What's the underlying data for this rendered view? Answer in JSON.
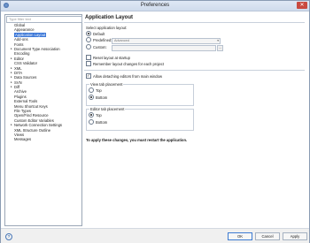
{
  "window": {
    "title": "Preferences"
  },
  "sidebar": {
    "filter_placeholder": "Type filter text",
    "items": [
      {
        "label": "Global",
        "expandable": false,
        "selected": false
      },
      {
        "label": "Appearance",
        "expandable": false,
        "selected": false
      },
      {
        "label": "Application Layout",
        "expandable": false,
        "selected": true
      },
      {
        "label": "Add-ons",
        "expandable": false,
        "selected": false
      },
      {
        "label": "Fonts",
        "expandable": false,
        "selected": false
      },
      {
        "label": "Document Type Association",
        "expandable": true,
        "selected": false
      },
      {
        "label": "Encoding",
        "expandable": false,
        "selected": false
      },
      {
        "label": "Editor",
        "expandable": true,
        "selected": false
      },
      {
        "label": "CSS Validator",
        "expandable": false,
        "selected": false
      },
      {
        "label": "XML",
        "expandable": true,
        "selected": false
      },
      {
        "label": "DITA",
        "expandable": true,
        "selected": false
      },
      {
        "label": "Data Sources",
        "expandable": true,
        "selected": false
      },
      {
        "label": "SVN",
        "expandable": true,
        "selected": false
      },
      {
        "label": "Diff",
        "expandable": true,
        "selected": false
      },
      {
        "label": "Archive",
        "expandable": false,
        "selected": false
      },
      {
        "label": "Plugins",
        "expandable": false,
        "selected": false
      },
      {
        "label": "External Tools",
        "expandable": false,
        "selected": false
      },
      {
        "label": "Menu Shortcut Keys",
        "expandable": false,
        "selected": false
      },
      {
        "label": "File Types",
        "expandable": false,
        "selected": false
      },
      {
        "label": "Open/Find Resource",
        "expandable": false,
        "selected": false
      },
      {
        "label": "Custom Editor Variables",
        "expandable": false,
        "selected": false
      },
      {
        "label": "Network Connection Settings",
        "expandable": true,
        "selected": false
      },
      {
        "label": "XML Structure Outline",
        "expandable": false,
        "selected": false
      },
      {
        "label": "Views",
        "expandable": false,
        "selected": false
      },
      {
        "label": "Messages",
        "expandable": false,
        "selected": false
      }
    ]
  },
  "main": {
    "title": "Application Layout",
    "select_layout_label": "Select application layout:",
    "layout_default": "Default",
    "layout_predefined": "Predefined:",
    "predefined_value": "Advanced",
    "layout_custom": "Custom:",
    "custom_browse": "...",
    "reset_layout": "Reset layout at startup",
    "remember_layout": "Remember layout changes for each project",
    "allow_detaching": "Allow detaching editors from main window",
    "view_tab_group": "View tab placement",
    "view_tab_top": "Top",
    "view_tab_bottom": "Bottom",
    "editor_tab_group": "Editor tab placement",
    "editor_tab_top": "Top",
    "editor_tab_bottom": "Bottom",
    "restart_note": "To apply these changes, you must restart the application."
  },
  "options_bar": {
    "global_options": "Global Options",
    "project_options": "Project Options",
    "restore_defaults": "Restore Defaults"
  },
  "footer": {
    "help": "?",
    "ok": "OK",
    "cancel": "Cancel",
    "apply": "Apply"
  }
}
